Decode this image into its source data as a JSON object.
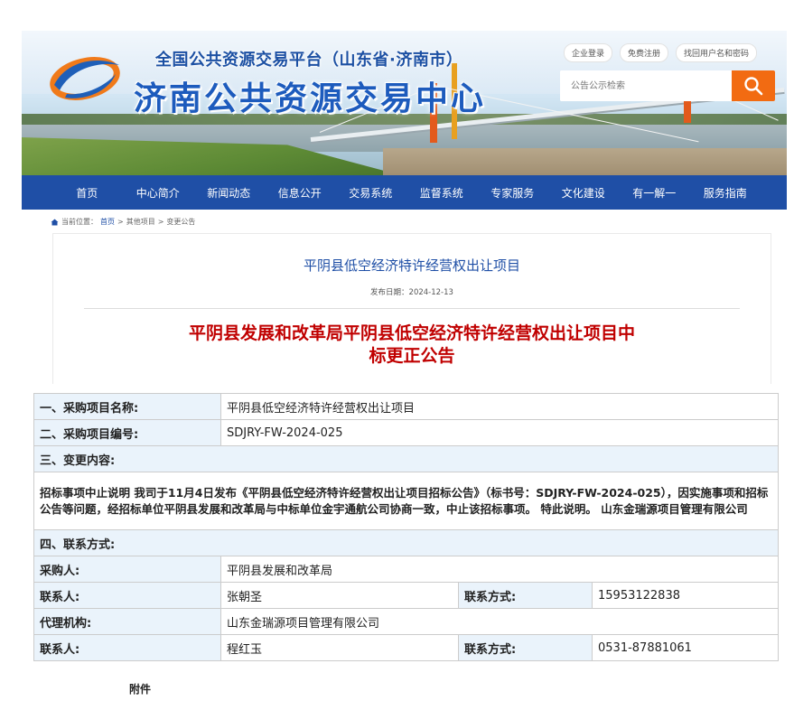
{
  "header": {
    "platform_title": "全国公共资源交易平台（山东省·济南市）",
    "site_name": "济南公共资源交易中心",
    "links": [
      "企业登录",
      "免费注册",
      "找回用户名和密码"
    ],
    "search_placeholder": "公告公示检索"
  },
  "nav": [
    "首页",
    "中心简介",
    "新闻动态",
    "信息公开",
    "交易系统",
    "监督系统",
    "专家服务",
    "文化建设",
    "有一解一",
    "服务指南"
  ],
  "breadcrumb": {
    "prefix": "当前位置：",
    "items": [
      "首页",
      "其他项目",
      "变更公告"
    ],
    "separator": ">"
  },
  "article": {
    "title": "平阴县低空经济特许经营权出让项目",
    "pub_date": "发布日期：2024-12-13",
    "notice_title_line1": "平阴县发展和改革局平阴县低空经济特许经营权出让项目中",
    "notice_title_line2": "标更正公告"
  },
  "table": {
    "project_name_label": "一、采购项目名称:",
    "project_name": "平阴县低空经济特许经营权出让项目",
    "project_no_label": "二、采购项目编号:",
    "project_no": "SDJRY-FW-2024-025",
    "change_label": "三、变更内容:",
    "change_text": "招标事项中止说明 我司于11月4日发布《平阴县低空经济特许经营权出让项目招标公告》（标书号：SDJRY-FW-2024-025），因实施事项和招标公告等问题，经招标单位平阴县发展和改革局与中标单位金宇通航公司协商一致，中止该招标事项。 特此说明。 山东金瑞源项目管理有限公司",
    "contact_section": "四、联系方式:",
    "purchaser_label": "采购人:",
    "purchaser": "平阴县发展和改革局",
    "contact1_label": "联系人:",
    "contact1": "张朝圣",
    "phone1_label": "联系方式:",
    "phone1": "15953122838",
    "agency_label": "代理机构:",
    "agency": "山东金瑞源项目管理有限公司",
    "contact2_label": "联系人:",
    "contact2": "程红玉",
    "phone2_label": "联系方式:",
    "phone2": "0531-87881061"
  },
  "attachment_label": "附件",
  "colors": {
    "nav_bg": "#1f4fa6",
    "accent_orange": "#f26b12",
    "notice_red": "#c00000",
    "label_bg": "#eaf3fb"
  }
}
